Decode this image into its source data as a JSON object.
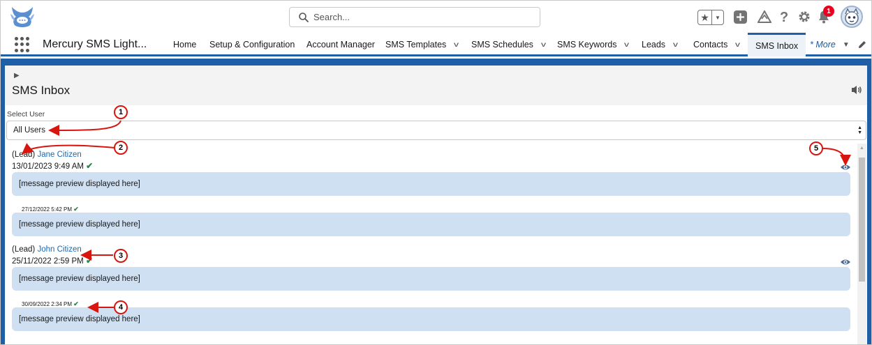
{
  "header": {
    "search_placeholder": "Search...",
    "notification_count": "1"
  },
  "nav": {
    "app_name": "Mercury SMS Light...",
    "tabs": [
      {
        "label": "Home"
      },
      {
        "label": "Setup & Configuration"
      },
      {
        "label": "Account Manager"
      },
      {
        "label": "SMS Templates"
      },
      {
        "label": "SMS Schedules"
      },
      {
        "label": "SMS Keywords"
      },
      {
        "label": "Leads"
      },
      {
        "label": "Contacts"
      },
      {
        "label": "SMS Inbox"
      },
      {
        "label": "* More"
      }
    ]
  },
  "page": {
    "title": "SMS Inbox",
    "select_label": "Select User",
    "select_value": "All Users"
  },
  "threads": [
    {
      "type": "(Lead)",
      "name": "Jane Citizen",
      "timestamp": "13/01/2023 9:49 AM",
      "preview": "[message preview displayed here]",
      "earlier": {
        "timestamp": "27/12/2022 5:42 PM",
        "preview": "[message preview displayed here]"
      }
    },
    {
      "type": "(Lead)",
      "name": "John Citizen",
      "timestamp": "25/11/2022 2:59 PM",
      "preview": "[message preview displayed here]",
      "earlier": {
        "timestamp": "30/09/2022 2:34 PM",
        "preview": "[message preview displayed here]"
      }
    }
  ],
  "annotations": [
    "1",
    "2",
    "3",
    "4",
    "5"
  ],
  "colors": {
    "brand_blue": "#1f5fa8",
    "bubble": "#cfe0f2",
    "link": "#1a6ab1",
    "check": "#2e844a",
    "annotation": "#d8150f"
  }
}
